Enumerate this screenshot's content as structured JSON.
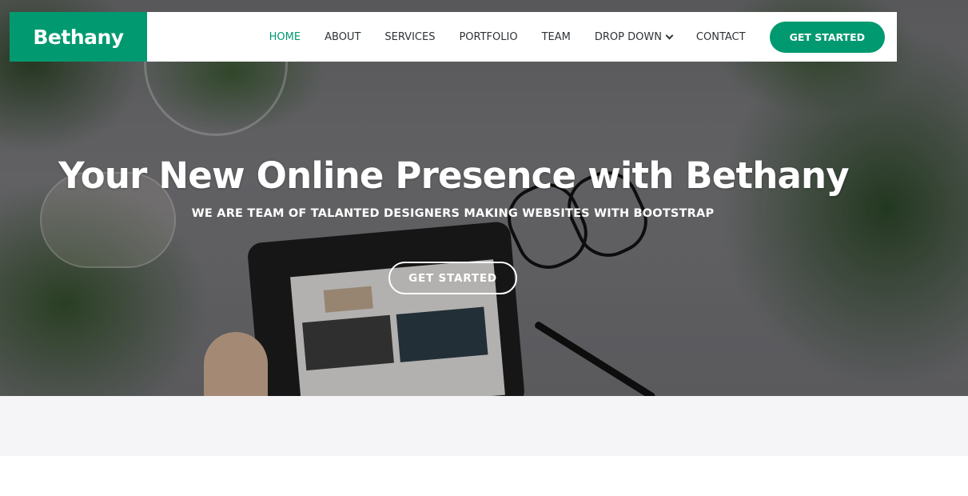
{
  "brand": {
    "logo": "Bethany",
    "accent": "#009970"
  },
  "nav": {
    "items": [
      {
        "label": "HOME",
        "active": true
      },
      {
        "label": "ABOUT"
      },
      {
        "label": "SERVICES"
      },
      {
        "label": "PORTFOLIO"
      },
      {
        "label": "TEAM"
      },
      {
        "label": "DROP DOWN",
        "icon": "chevron-down-icon"
      },
      {
        "label": "CONTACT"
      }
    ],
    "cta_label": "GET STARTED"
  },
  "hero": {
    "title": "Your New Online Presence with Bethany",
    "subtitle": "WE ARE TEAM OF TALANTED DESIGNERS MAKING WEBSITES WITH BOOTSTRAP",
    "button_label": "GET STARTED"
  }
}
